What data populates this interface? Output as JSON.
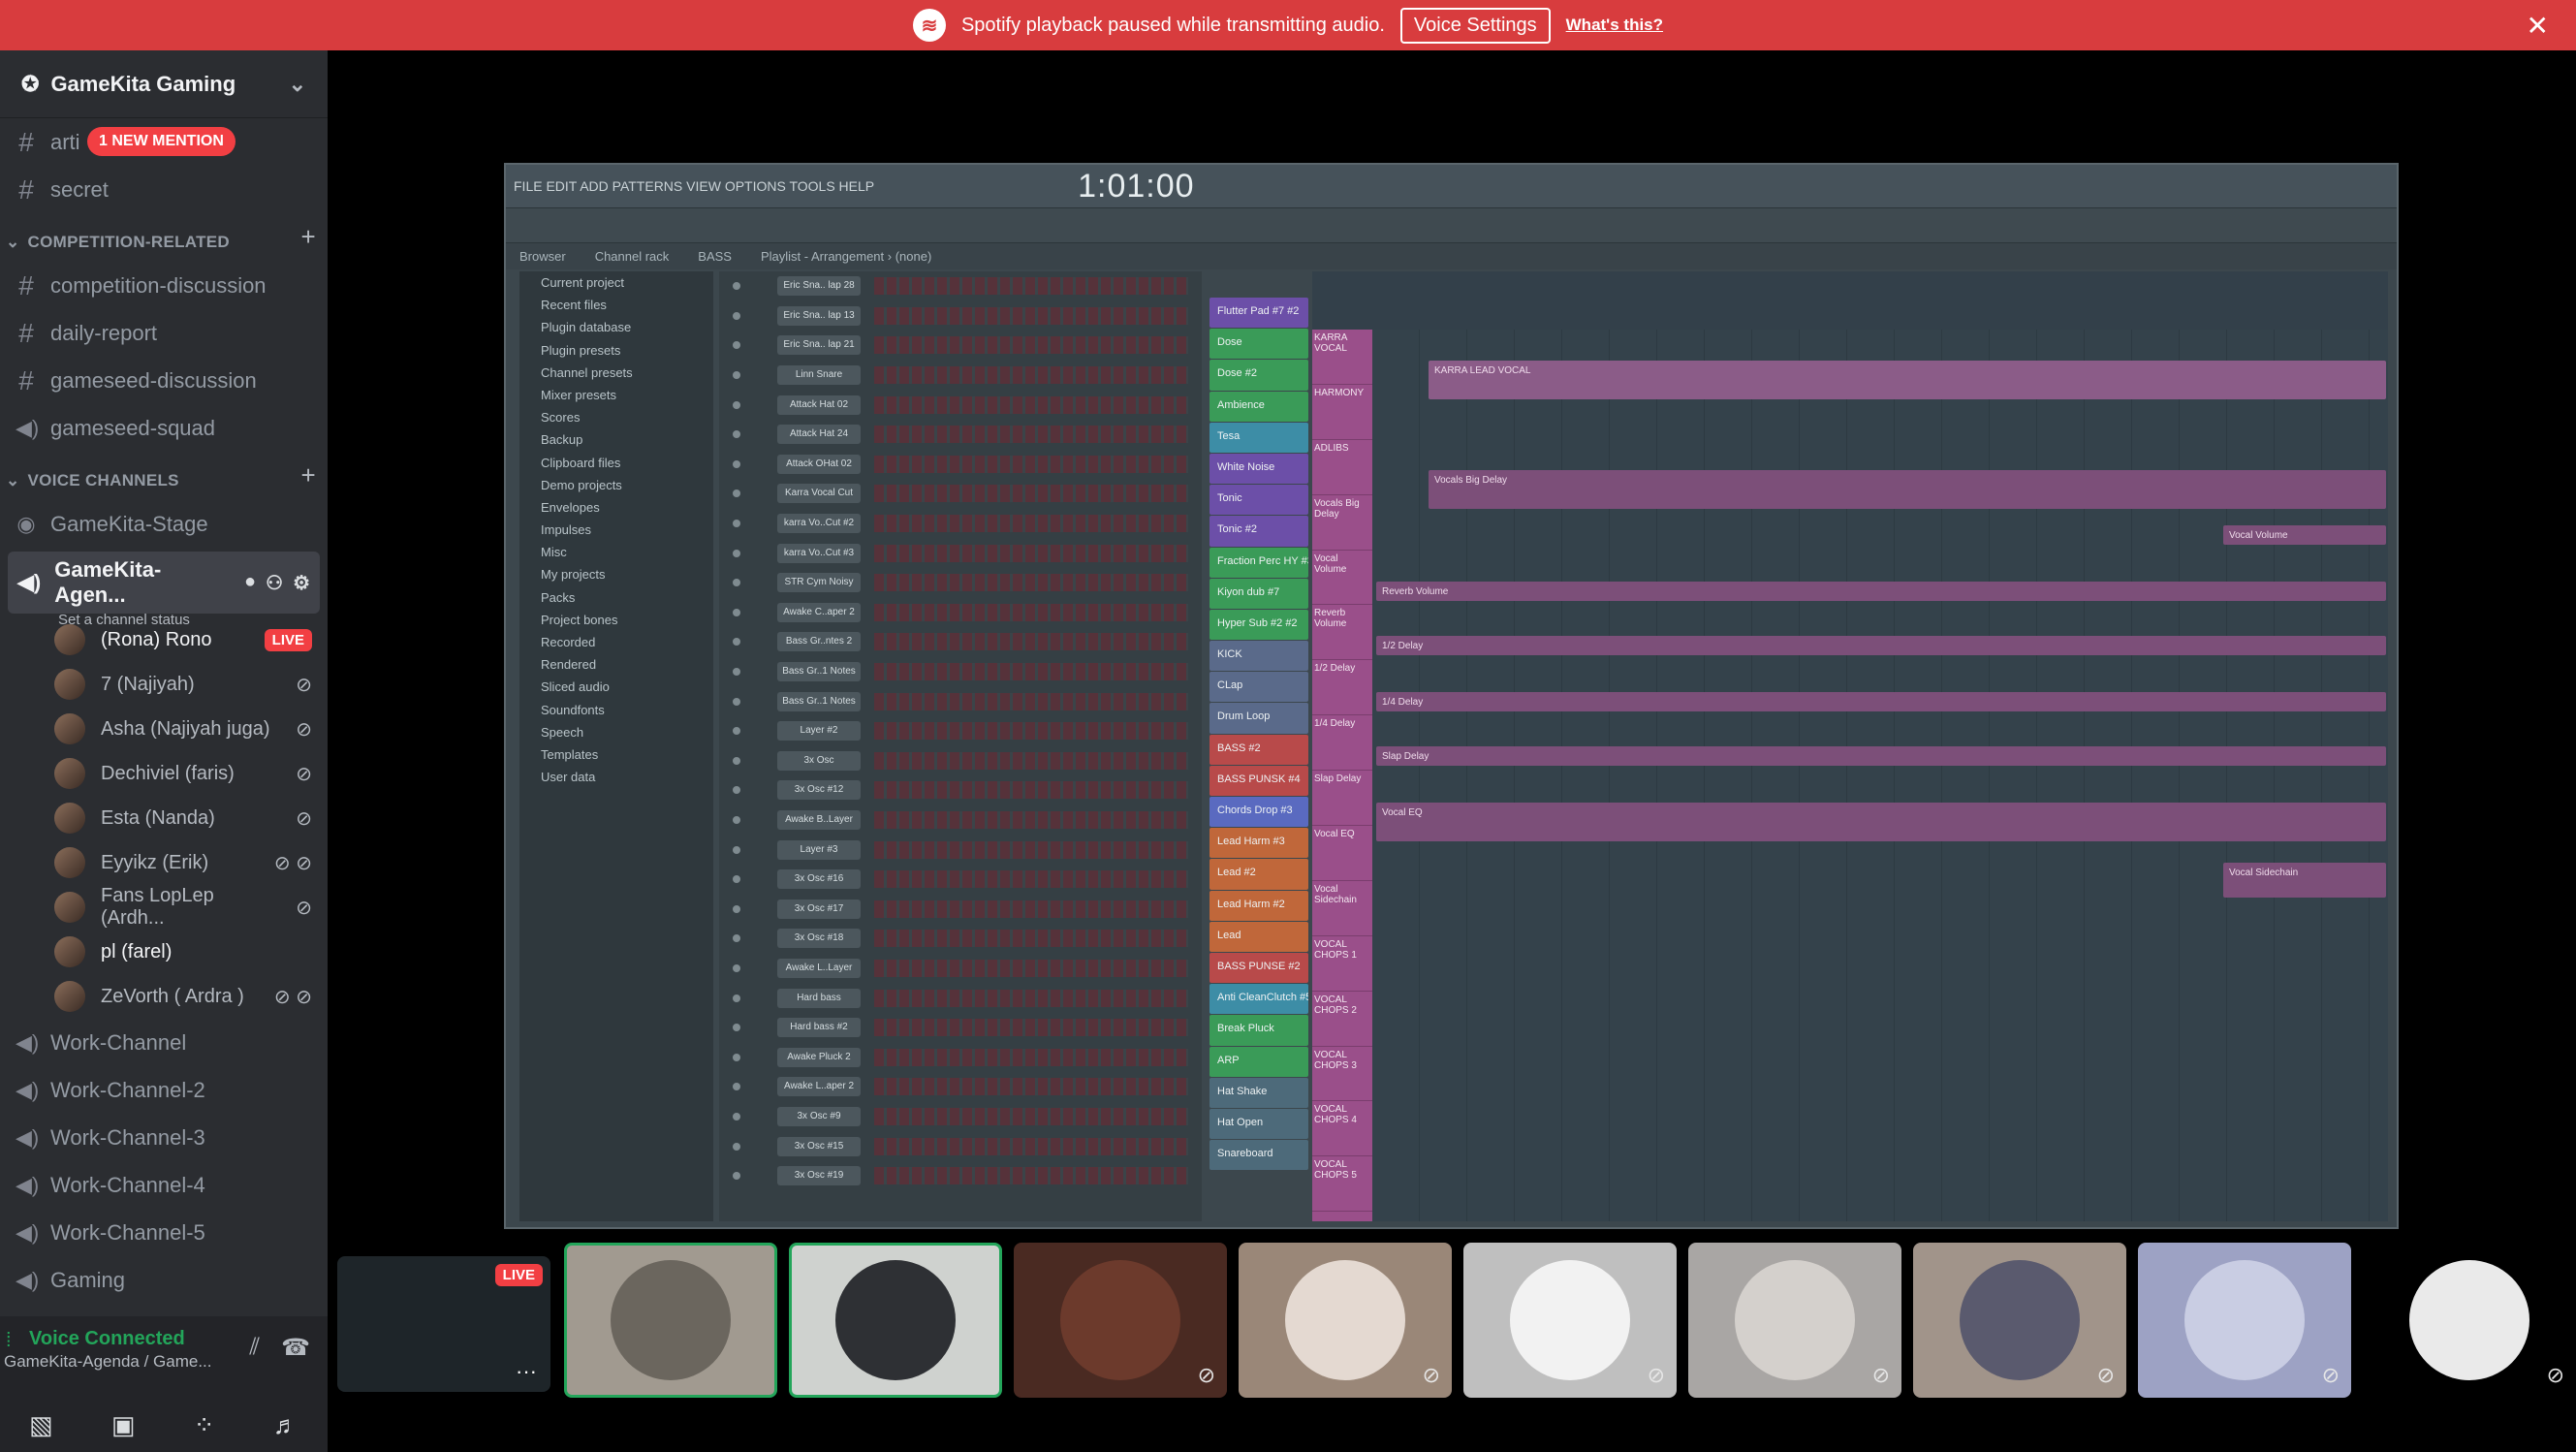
{
  "banner": {
    "message": "Spotify playback paused while transmitting audio.",
    "voice_settings": "Voice Settings",
    "whats_this": "What's this?",
    "close": "✕"
  },
  "server": {
    "name": "GameKita Gaming"
  },
  "channels_top": [
    {
      "name": "arti",
      "badge": "1 NEW MENTION"
    },
    {
      "name": "secret"
    }
  ],
  "category_competition": {
    "label": "COMPETITION-RELATED",
    "channels": [
      "competition-discussion",
      "daily-report",
      "gameseed-discussion",
      "gameseed-squad"
    ]
  },
  "category_voice": {
    "label": "VOICE CHANNELS",
    "stage": "GameKita-Stage",
    "active": {
      "name": "GameKita-Agen...",
      "status": "Set a channel status"
    },
    "users": [
      {
        "name": "(Rona) Rono",
        "live": "LIVE"
      },
      {
        "name": "7 (Najiyah)"
      },
      {
        "name": "Asha (Najiyah juga)"
      },
      {
        "name": "Dechiviel (faris)"
      },
      {
        "name": "Esta (Nanda)"
      },
      {
        "name": "Eyyikz (Erik)"
      },
      {
        "name": "Fans LopLep (Ardh..."
      },
      {
        "name": "pl (farel)"
      },
      {
        "name": "ZeVorth ( Ardra )"
      }
    ],
    "channels": [
      "Work-Channel",
      "Work-Channel-2",
      "Work-Channel-3",
      "Work-Channel-4",
      "Work-Channel-5",
      "Gaming"
    ]
  },
  "voice_panel": {
    "title": "Voice Connected",
    "subtitle": "GameKita-Agenda / Game..."
  },
  "fl": {
    "menu": "FILE  EDIT  ADD  PATTERNS  VIEW  OPTIONS  TOOLS  HELP",
    "time": "1:01:00",
    "mode": "BASS",
    "browser_header": "Browser",
    "channel_rack": "Channel rack",
    "playlist_header": "Playlist - Arrangement › (none)",
    "browser_items": [
      "Current project",
      "Recent files",
      "Plugin database",
      "Plugin presets",
      "Channel presets",
      "Mixer presets",
      "Scores",
      "Backup",
      "Clipboard files",
      "Demo projects",
      "Envelopes",
      "Impulses",
      "Misc",
      "My projects",
      "Packs",
      "Project bones",
      "Recorded",
      "Rendered",
      "Sliced audio",
      "Soundfonts",
      "Speech",
      "Templates",
      "User data"
    ],
    "rack_channels": [
      "Eric Sna.. lap 28",
      "Eric Sna.. lap 13",
      "Eric Sna.. lap 21",
      "Linn Snare",
      "Attack Hat 02",
      "Attack Hat 24",
      "Attack OHat 02",
      "Karra Vocal Cut",
      "karra Vo..Cut #2",
      "karra Vo..Cut #3",
      "STR Cym Noisy",
      "Awake C..aper 2",
      "Bass Gr..ntes 2",
      "Bass Gr..1 Notes",
      "Bass Gr..1 Notes",
      "Layer #2",
      "3x Osc",
      "3x Osc #12",
      "Awake B..Layer",
      "Layer #3",
      "3x Osc #16",
      "3x Osc #17",
      "3x Osc #18",
      "Awake L..Layer",
      "Hard bass",
      "Hard bass #2",
      "Awake Pluck 2",
      "Awake L..aper 2",
      "3x Osc #9",
      "3x Osc #15",
      "3x Osc #19"
    ],
    "mixer_tracks": [
      "Flutter Pad #7 #2",
      "Dose",
      "Dose #2",
      "Ambience",
      "Tesa",
      "White Noise",
      "Tonic",
      "Tonic #2",
      "Fraction Perc HY #3",
      "Kiyon dub #7",
      "Hyper Sub #2 #2",
      "KICK",
      "CLap",
      "Drum Loop",
      "BASS #2",
      "BASS PUNSK #4",
      "Chords Drop #3",
      "Lead Harm #3",
      "Lead #2",
      "Lead Harm #2",
      "Lead",
      "BASS PUNSE #2",
      "Anti CleanClutch #5",
      "Break Pluck",
      "ARP",
      "Hat Shake",
      "Hat Open",
      "Snareboard"
    ],
    "playlist_tracks": [
      "KARRA VOCAL",
      "HARMONY",
      "ADLIBS",
      "Vocals Big Delay",
      "Vocal Volume",
      "Reverb Volume",
      "1/2 Delay",
      "1/4 Delay",
      "Slap Delay",
      "Vocal EQ",
      "Vocal Sidechain",
      "VOCAL CHOPS 1",
      "VOCAL CHOPS 2",
      "VOCAL CHOPS 3",
      "VOCAL CHOPS 4",
      "VOCAL CHOPS 5"
    ],
    "clips": [
      "KARRA LEAD VOCAL",
      "Vocals Big Delay",
      "Reverb Volume",
      "1/2 Delay",
      "1/4 Delay",
      "Slap Delay",
      "Vocal EQ",
      "Vocal Volume",
      "Vocal Sidechain"
    ]
  },
  "stream_tile": {
    "live": "LIVE",
    "more": "···"
  }
}
